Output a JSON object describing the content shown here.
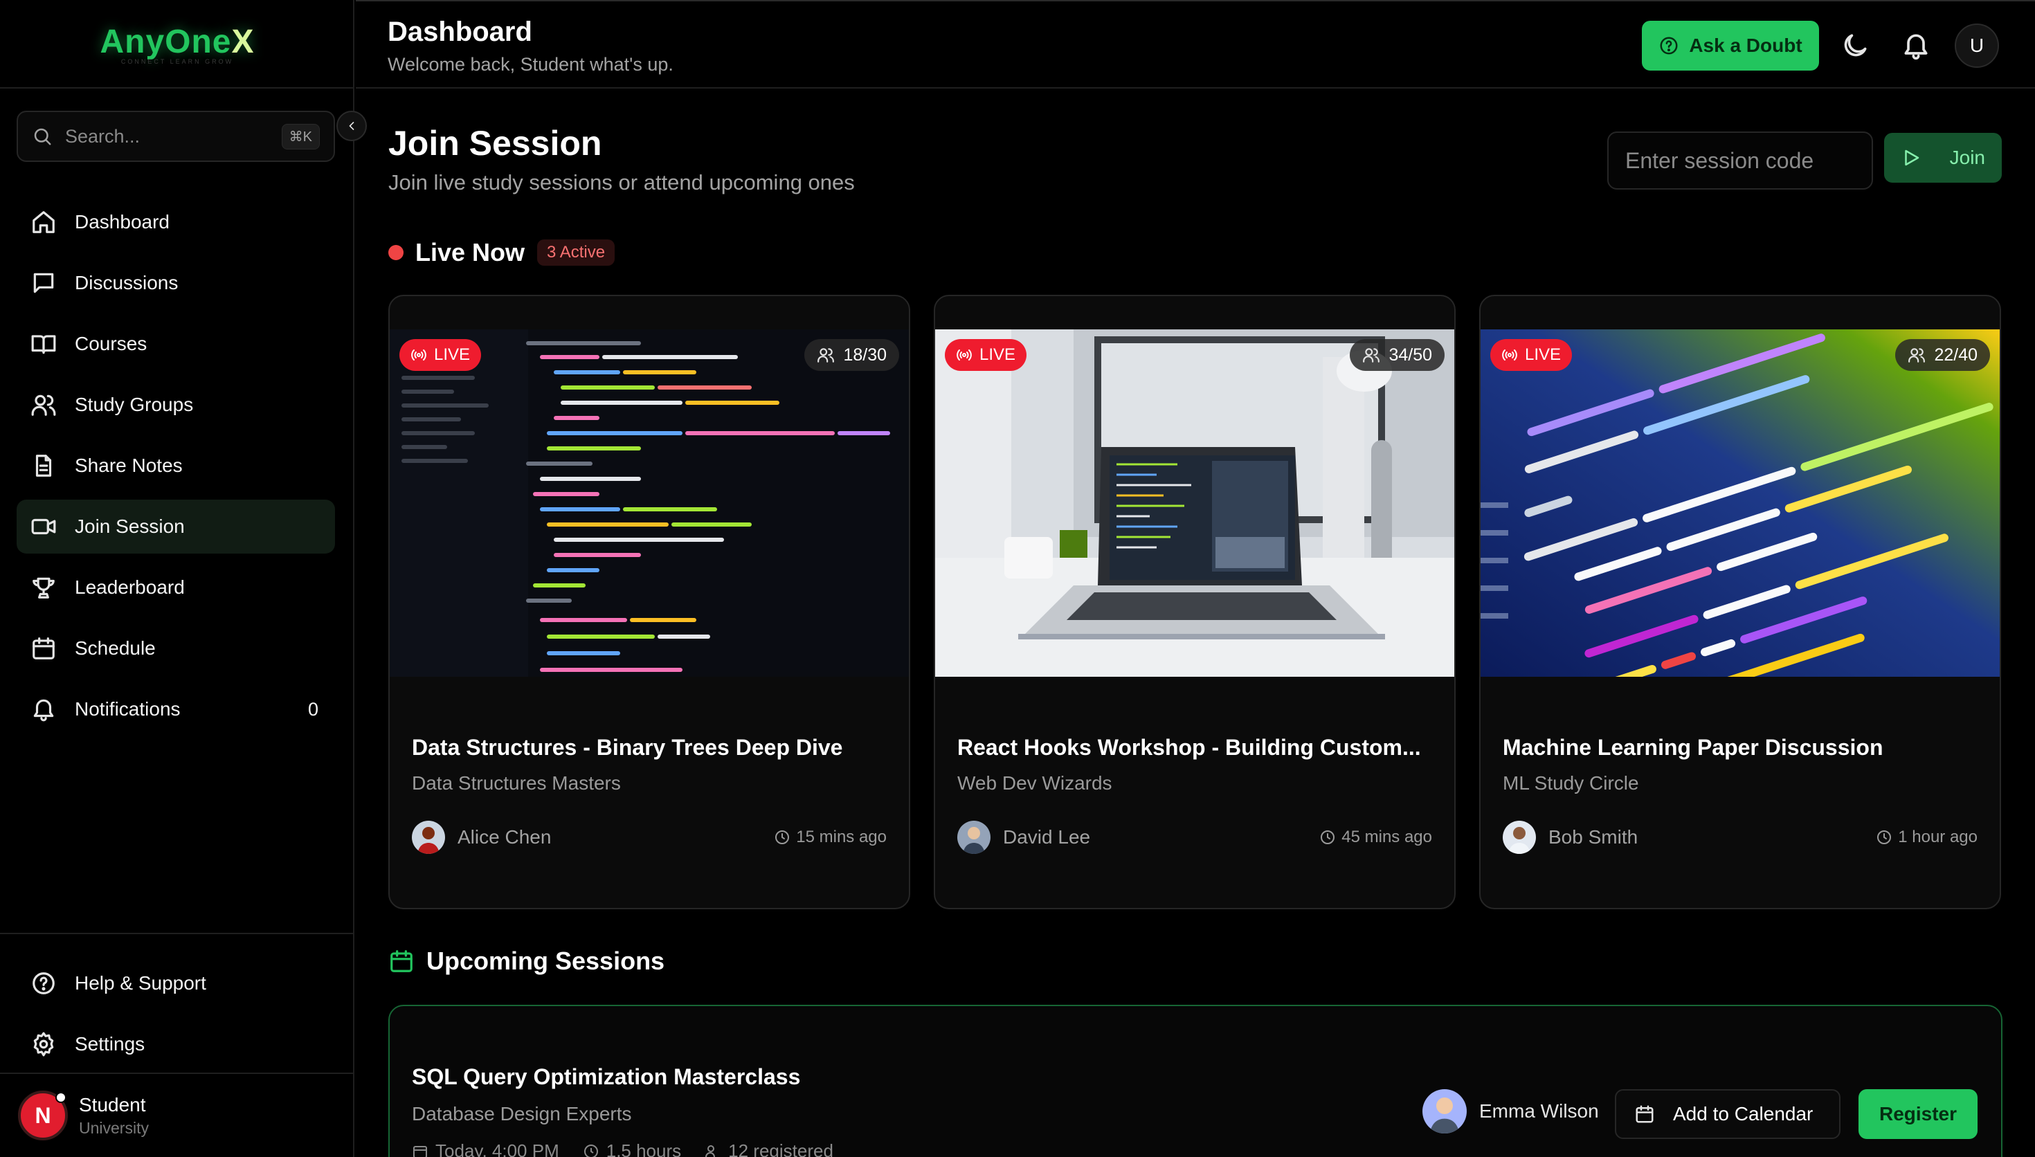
{
  "brand": {
    "name_main": "AnyOne",
    "name_accent": "X",
    "tagline": "CONNECT LEARN GROW"
  },
  "search": {
    "placeholder": "Search...",
    "shortcut": "⌘K"
  },
  "nav": [
    {
      "label": "Dashboard",
      "icon": "home-icon"
    },
    {
      "label": "Discussions",
      "icon": "message-square-icon"
    },
    {
      "label": "Courses",
      "icon": "book-open-icon"
    },
    {
      "label": "Study Groups",
      "icon": "users-icon"
    },
    {
      "label": "Share Notes",
      "icon": "file-text-icon"
    },
    {
      "label": "Join Session",
      "icon": "video-icon",
      "active": true
    },
    {
      "label": "Leaderboard",
      "icon": "trophy-icon"
    },
    {
      "label": "Schedule",
      "icon": "calendar-icon"
    },
    {
      "label": "Notifications",
      "icon": "bell-icon",
      "count": "0"
    }
  ],
  "nav_bottom": [
    {
      "label": "Help & Support",
      "icon": "help-circle-icon"
    },
    {
      "label": "Settings",
      "icon": "gear-icon"
    }
  ],
  "user": {
    "initial": "N",
    "name": "Student",
    "subtitle": "University"
  },
  "header": {
    "title": "Dashboard",
    "subtitle": "Welcome back, Student what's up.",
    "ask_label": "Ask a Doubt",
    "avatar_initial": "U"
  },
  "page": {
    "title": "Join Session",
    "subtitle": "Join live study sessions or attend upcoming ones",
    "code_placeholder": "Enter session code",
    "join_label": "Join"
  },
  "live": {
    "title": "Live Now",
    "badge": "3 Active",
    "sessions": [
      {
        "badge": "LIVE",
        "participants": "18/30",
        "title": "Data Structures - Binary Trees Deep Dive",
        "group": "Data Structures Masters",
        "host": "Alice Chen",
        "time": "15 mins ago"
      },
      {
        "badge": "LIVE",
        "participants": "34/50",
        "title": "React Hooks Workshop - Building Custom...",
        "group": "Web Dev Wizards",
        "host": "David Lee",
        "time": "45 mins ago"
      },
      {
        "badge": "LIVE",
        "participants": "22/40",
        "title": "Machine Learning Paper Discussion",
        "group": "ML Study Circle",
        "host": "Bob Smith",
        "time": "1 hour ago"
      }
    ]
  },
  "upcoming": {
    "title": "Upcoming Sessions",
    "sessions": [
      {
        "title": "SQL Query Optimization Masterclass",
        "group": "Database Design Experts",
        "date": "Today, 4:00 PM",
        "duration": "1.5 hours",
        "registered": "12 registered",
        "host": "Emma Wilson",
        "calendar_label": "Add to Calendar",
        "register_label": "Register"
      }
    ]
  },
  "colors": {
    "accent": "#22c55e",
    "live": "#ef1c2e",
    "background": "#000000",
    "card": "#0b0b0b"
  }
}
